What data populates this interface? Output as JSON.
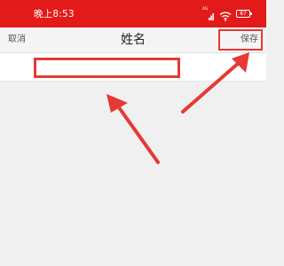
{
  "status_bar": {
    "time": "晚上8:53",
    "signal_label": "4G",
    "battery_level": "87",
    "background_color": "#e31a1a"
  },
  "header": {
    "cancel_label": "取消",
    "title": "姓名",
    "save_label": "保存"
  },
  "form": {
    "name_value": "",
    "name_placeholder": ""
  },
  "annotations": {
    "highlight_color": "#e53935"
  },
  "icons": [
    "signal-icon",
    "wifi-icon",
    "battery-icon"
  ]
}
